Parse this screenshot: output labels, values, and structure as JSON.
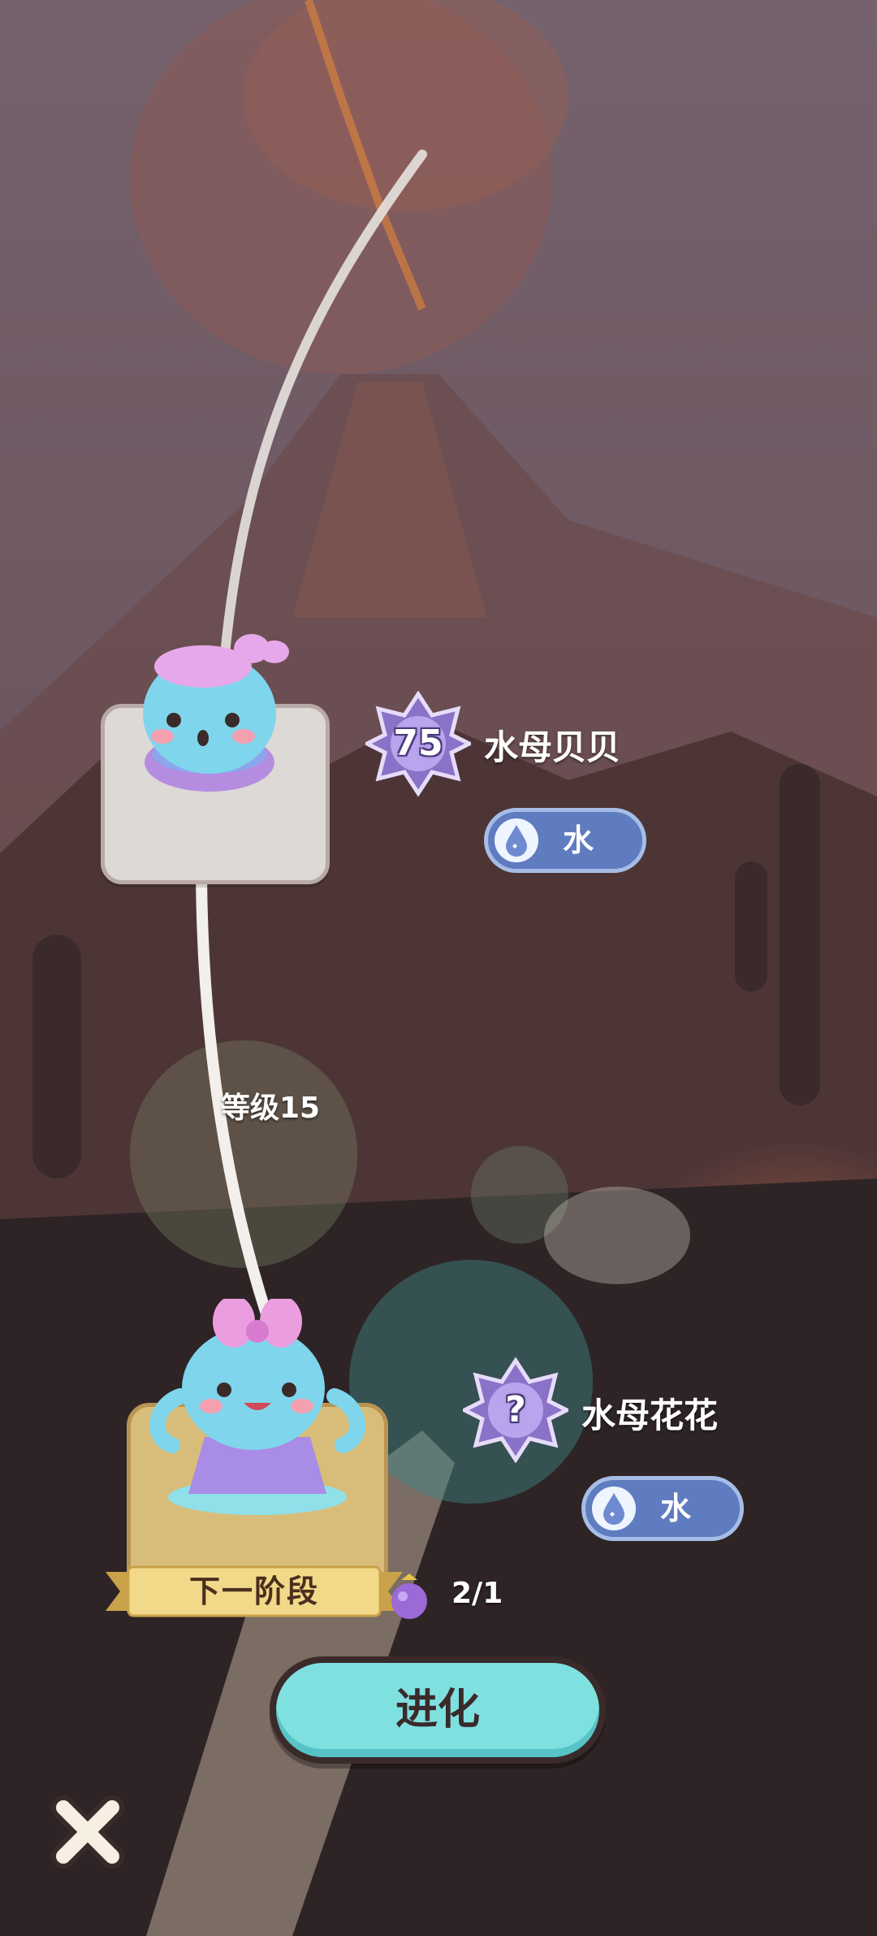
{
  "current_stage": {
    "level_badge": "75",
    "name": "水母贝贝",
    "element_label": "水",
    "element_icon": "water-drop-icon"
  },
  "evolution_requirement": {
    "level_label": "等级15"
  },
  "next_stage": {
    "level_badge": "?",
    "name": "水母花花",
    "element_label": "水",
    "element_icon": "water-drop-icon",
    "ribbon_label": "下一阶段"
  },
  "evolution_item": {
    "icon": "purple-fruit-icon",
    "count": "2/1"
  },
  "actions": {
    "evolve_label": "进化",
    "close_icon": "close-icon"
  },
  "colors": {
    "accent_button": "#7fe0e0",
    "element_water": "#5f7cc0",
    "badge_purple": "#8a72c8"
  }
}
